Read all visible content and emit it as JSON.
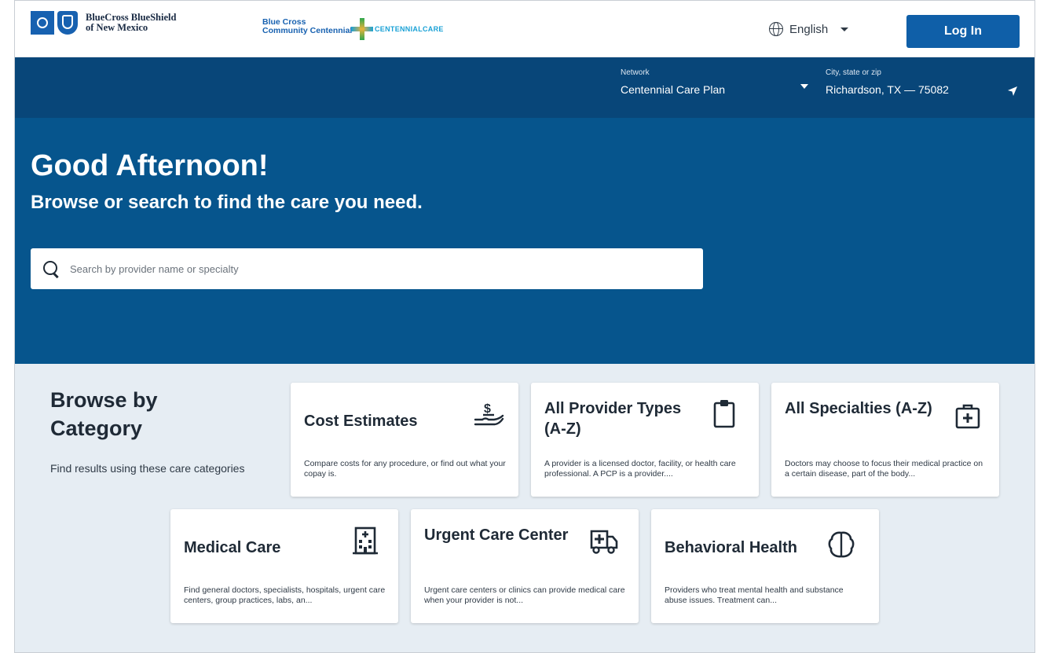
{
  "header": {
    "brand_line1": "BlueCross BlueShield",
    "brand_line2": "of New Mexico",
    "partner_line1": "Blue Cross",
    "partner_line2": "Community Centennial™",
    "partner2": "CENTENNIALCARE",
    "language": "English",
    "login_label": "Log In"
  },
  "network_bar": {
    "network_label": "Network",
    "network_value": "Centennial Care Plan",
    "location_label": "City, state or zip",
    "location_value": "Richardson, TX — 75082"
  },
  "hero": {
    "greeting": "Good Afternoon!",
    "subtitle": "Browse or search to find the care you need.",
    "search_placeholder": "Search by provider name or specialty"
  },
  "browse": {
    "title": "Browse by Category",
    "description": "Find results using these care categories",
    "cards": [
      {
        "title": "Cost Estimates",
        "description": "Compare costs for any procedure, or find out what your copay is.",
        "icon": "hand-dollar-icon"
      },
      {
        "title": "All Provider Types (A-Z)",
        "description": "A provider is a licensed doctor, facility, or health care professional. A PCP is a provider....",
        "icon": "clipboard-icon"
      },
      {
        "title": "All Specialties (A-Z)",
        "description": "Doctors may choose to focus their medical practice on a certain disease, part of the body...",
        "icon": "medical-kit-icon"
      },
      {
        "title": "Medical Care",
        "description": "Find general doctors, specialists, hospitals, urgent care centers, group practices, labs, an...",
        "icon": "hospital-icon"
      },
      {
        "title": "Urgent Care Center",
        "description": "Urgent care centers or clinics can provide medical care when your provider is not...",
        "icon": "ambulance-icon"
      },
      {
        "title": "Behavioral Health",
        "description": "Providers who treat mental health and substance abuse issues. Treatment can...",
        "icon": "brain-icon"
      }
    ]
  },
  "colors": {
    "brand_blue": "#0f5fa8",
    "network_bar": "#084679",
    "hero": "#06558d",
    "browse_bg": "#e6edf3"
  }
}
